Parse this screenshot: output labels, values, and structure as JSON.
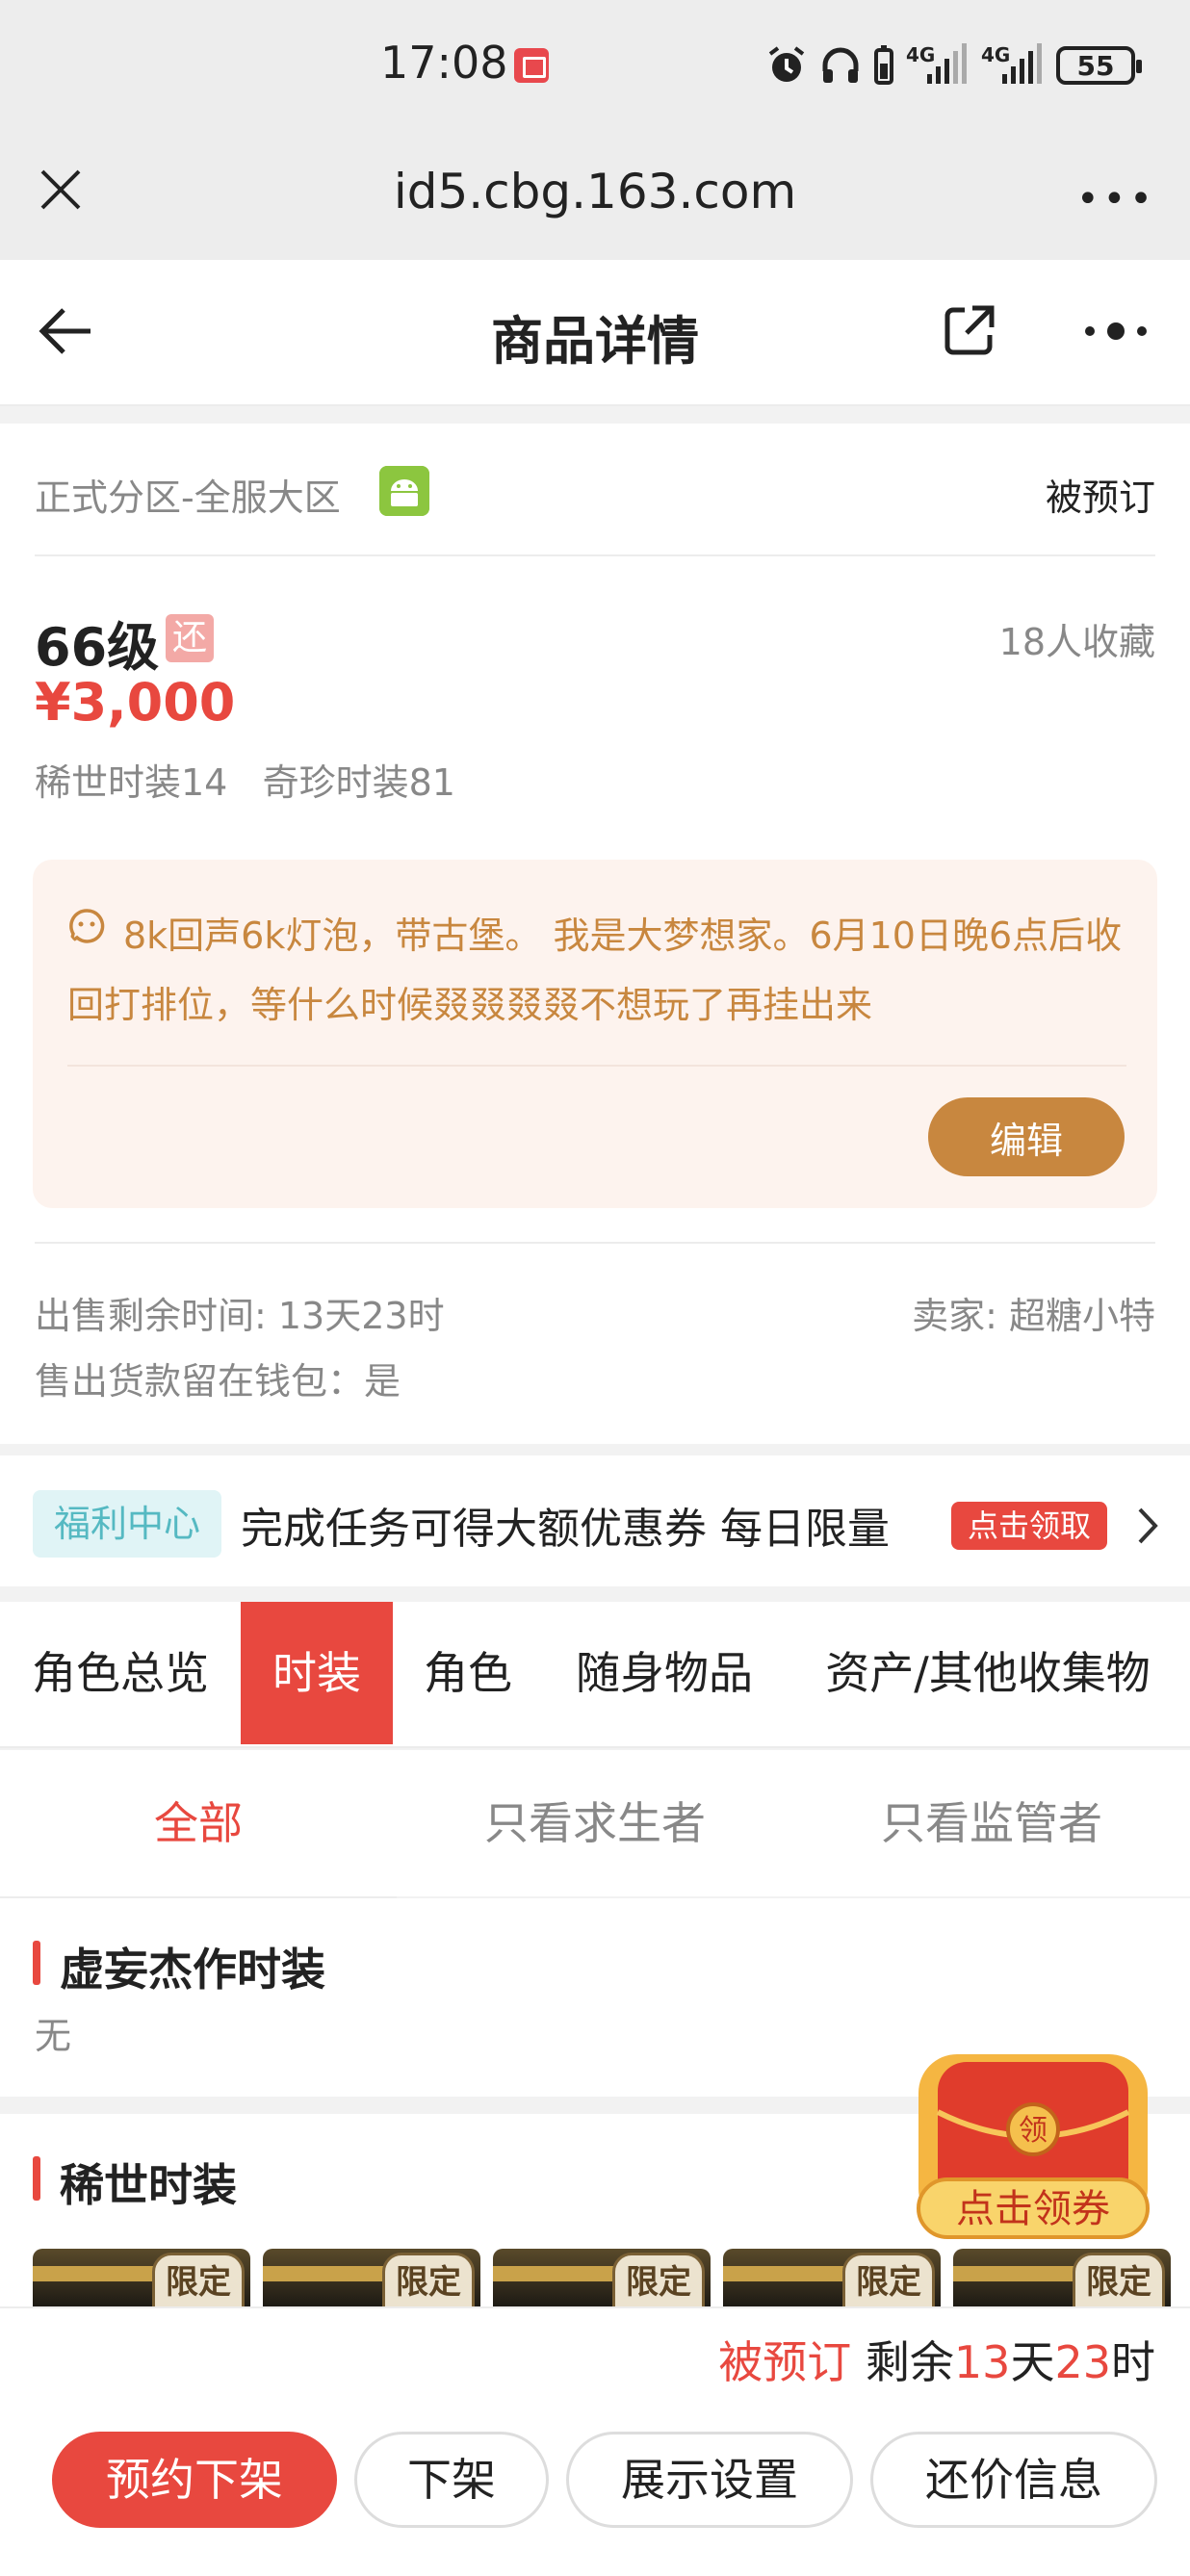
{
  "status_bar": {
    "time": "17:08",
    "signal1": "4G",
    "signal2": "4G",
    "battery": "55"
  },
  "browser": {
    "url": "id5.cbg.163.com"
  },
  "nav": {
    "title": "商品详情"
  },
  "listing": {
    "server": "正式分区-全服大区",
    "status": "被预订",
    "level": "66级",
    "level_badge": "还",
    "favorites": "18人收藏",
    "price": "¥3,000",
    "skins_summary": "稀世时装14   奇珍时装81",
    "note": "8k回声6k灯泡，带古堡。 我是大梦想家。6月10日晚6点后收回打排位，等什么时候叕叕叕叕不想玩了再挂出来",
    "edit_label": "编辑",
    "remaining_time": "出售剩余时间: 13天23时",
    "seller": "卖家: 超糖小特",
    "wallet": "售出货款留在钱包：是"
  },
  "welfare": {
    "tag": "福利中心",
    "text": "完成任务可得大额优惠券 每日限量",
    "claim": "点击领取"
  },
  "tabs": [
    "角色总览",
    "时装",
    "角色",
    "随身物品",
    "资产/其他收集物"
  ],
  "active_tab": "时装",
  "sub_tabs": [
    "全部",
    "只看求生者",
    "只看监管者"
  ],
  "sections": {
    "illusory": {
      "title": "虚妄杰作时装",
      "empty": "无"
    },
    "rare": {
      "title": "稀世时装",
      "item_tag": "限定"
    }
  },
  "coupon_float": {
    "label": "点击领券",
    "seal": "领"
  },
  "bottom": {
    "status": "被预订",
    "remain_prefix": "剩余",
    "days": "13",
    "day_unit": "天",
    "hours": "23",
    "hour_unit": "时",
    "buttons": {
      "reserve_delist": "预约下架",
      "delist": "下架",
      "display_settings": "展示设置",
      "counter_offer": "还价信息"
    }
  },
  "colors": {
    "accent": "#e8483f",
    "gold": "#c8873f",
    "teal": "#55b9c2"
  }
}
